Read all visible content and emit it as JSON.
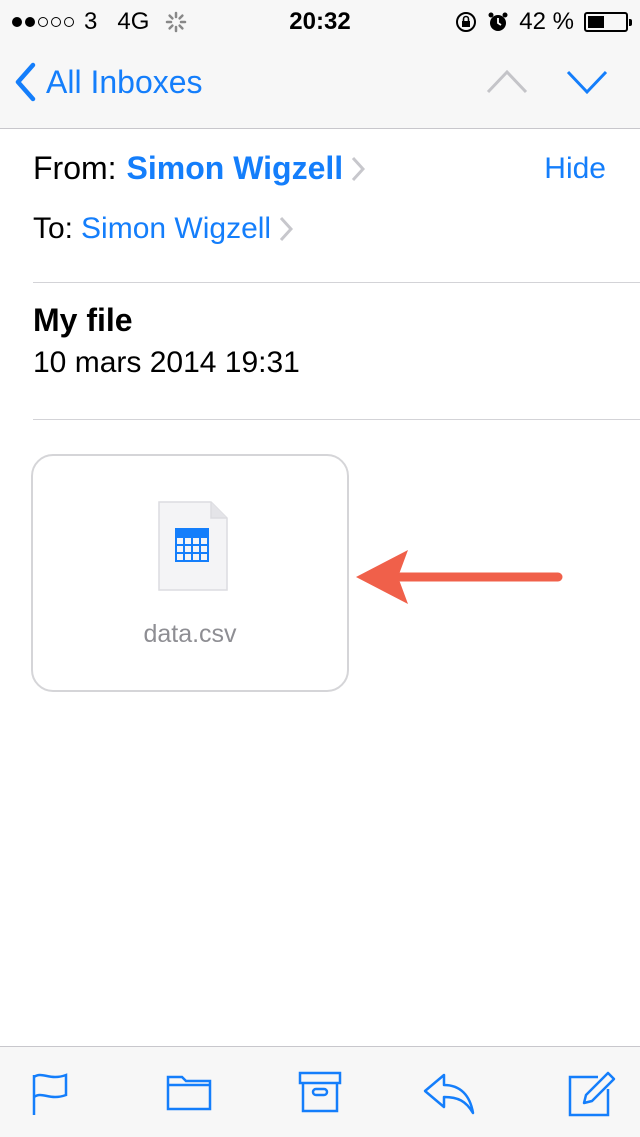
{
  "status": {
    "carrier": "3",
    "network": "4G",
    "time": "20:32",
    "battery": "42 %",
    "signal_bars": 2,
    "battery_level": 0.42
  },
  "nav": {
    "back_label": "All Inboxes"
  },
  "header": {
    "from_label": "From:",
    "from_name": "Simon Wigzell",
    "hide_label": "Hide",
    "to_label": "To:",
    "to_name": "Simon Wigzell"
  },
  "message": {
    "subject": "My file",
    "date": "10 mars 2014 19:31"
  },
  "attachment": {
    "filename": "data.csv"
  },
  "colors": {
    "accent": "#147efb",
    "arrow": "#f0604a"
  },
  "toolbar": {
    "icons": [
      "flag-icon",
      "folder-icon",
      "archive-icon",
      "reply-icon",
      "compose-icon"
    ]
  }
}
